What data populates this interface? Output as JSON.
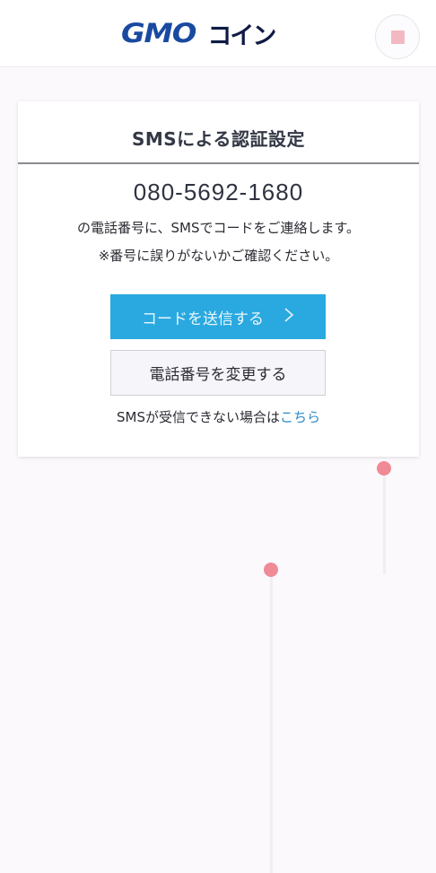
{
  "header": {
    "logo_latin": "GMO",
    "logo_kana": "コイン",
    "menu_icon": "menu-icon"
  },
  "card": {
    "title": "SMSによる認証設定",
    "phone_number": "080-5692-1680",
    "description_line1": "の電話番号に、SMSでコードをご連絡します。",
    "description_line2": "※番号に誤りがないかご確認ください。",
    "send_button_label": "コードを送信する",
    "send_button_icon": "chevron-right-icon",
    "change_button_label": "電話番号を変更する",
    "help_text": "SMSが受信できない場合は",
    "help_link": "こちら"
  },
  "colors": {
    "brand_blue": "#1a4aa0",
    "primary_button": "#2aa9e0",
    "link": "#2a8ac9",
    "decor_dot": "#f08a96"
  }
}
